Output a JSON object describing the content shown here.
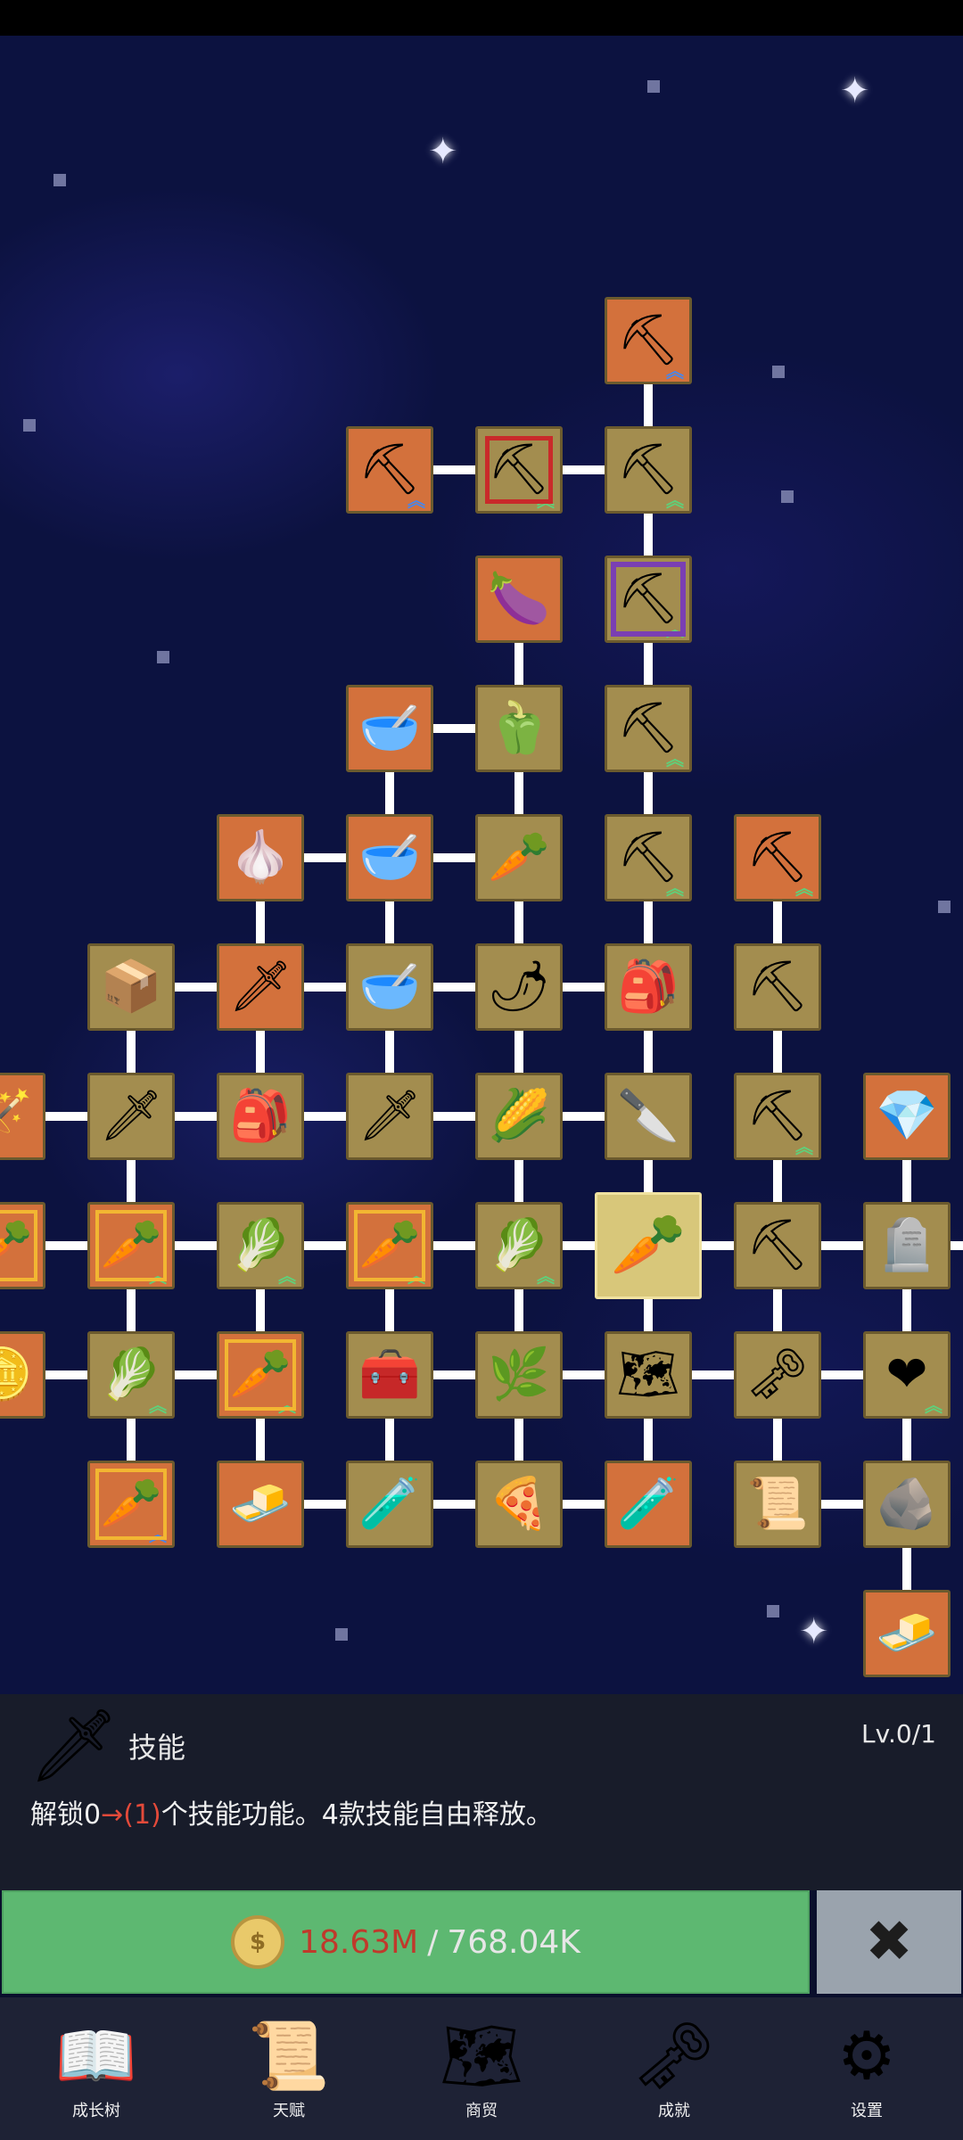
{
  "skill_tree": {
    "nodes": [
      {
        "col": 4,
        "row": 0,
        "color": "orange",
        "icon": "shovel-icon",
        "glyph": "⛏",
        "up": "blue"
      },
      {
        "col": 2,
        "row": 1,
        "color": "orange",
        "icon": "shovel-icon",
        "glyph": "⛏",
        "up": "blue"
      },
      {
        "col": 3,
        "row": 1,
        "color": "olive",
        "icon": "shovel-icon",
        "glyph": "⛏",
        "up": "green",
        "frame": "red"
      },
      {
        "col": 4,
        "row": 1,
        "color": "olive",
        "icon": "shovel-icon",
        "glyph": "⛏",
        "up": "green"
      },
      {
        "col": 3,
        "row": 2,
        "color": "orange",
        "icon": "eggplant-icon",
        "glyph": "🍆"
      },
      {
        "col": 4,
        "row": 2,
        "color": "olive",
        "icon": "shovel-icon",
        "glyph": "⛏",
        "up": "green",
        "frame": "purple"
      },
      {
        "col": 2,
        "row": 3,
        "color": "orange",
        "icon": "bowl-icon",
        "glyph": "🥣"
      },
      {
        "col": 3,
        "row": 3,
        "color": "olive",
        "icon": "pepper-icon",
        "glyph": "🫑"
      },
      {
        "col": 4,
        "row": 3,
        "color": "olive",
        "icon": "shovel-icon",
        "glyph": "⛏",
        "up": "green"
      },
      {
        "col": 1,
        "row": 4,
        "color": "orange",
        "icon": "garlic-icon",
        "glyph": "🧄"
      },
      {
        "col": 2,
        "row": 4,
        "color": "orange",
        "icon": "bowl-icon",
        "glyph": "🥣"
      },
      {
        "col": 3,
        "row": 4,
        "color": "olive",
        "icon": "radish-icon",
        "glyph": "🥕"
      },
      {
        "col": 4,
        "row": 4,
        "color": "olive",
        "icon": "shovel-icon",
        "glyph": "⛏",
        "up": "green"
      },
      {
        "col": 5,
        "row": 4,
        "color": "orange",
        "icon": "pickaxe-icon",
        "glyph": "⛏",
        "up": "green"
      },
      {
        "col": 0,
        "row": 5,
        "color": "olive",
        "icon": "crate-icon",
        "glyph": "📦"
      },
      {
        "col": 1,
        "row": 5,
        "color": "orange",
        "icon": "sword-icon",
        "glyph": "🗡"
      },
      {
        "col": 2,
        "row": 5,
        "color": "olive",
        "icon": "bowl-icon",
        "glyph": "🥣"
      },
      {
        "col": 3,
        "row": 5,
        "color": "olive",
        "icon": "chili-icon",
        "glyph": "🌶"
      },
      {
        "col": 4,
        "row": 5,
        "color": "olive",
        "icon": "backpack-icon",
        "glyph": "🎒"
      },
      {
        "col": 5,
        "row": 5,
        "color": "olive",
        "icon": "pickaxe-icon",
        "glyph": "⛏"
      },
      {
        "col": -1,
        "row": 6,
        "color": "orange",
        "icon": "staff-icon",
        "glyph": "🪄"
      },
      {
        "col": 0,
        "row": 6,
        "color": "olive",
        "icon": "sword-icon",
        "glyph": "🗡"
      },
      {
        "col": 1,
        "row": 6,
        "color": "olive",
        "icon": "backpack-icon",
        "glyph": "🎒"
      },
      {
        "col": 2,
        "row": 6,
        "color": "olive",
        "icon": "sword-icon",
        "glyph": "🗡"
      },
      {
        "col": 3,
        "row": 6,
        "color": "olive",
        "icon": "corn-icon",
        "glyph": "🌽"
      },
      {
        "col": 4,
        "row": 6,
        "color": "olive",
        "icon": "dagger-icon",
        "glyph": "🔪"
      },
      {
        "col": 5,
        "row": 6,
        "color": "olive",
        "icon": "pickaxe-icon",
        "glyph": "⛏",
        "up": "green"
      },
      {
        "col": 6,
        "row": 6,
        "color": "orange",
        "icon": "crystal-icon",
        "glyph": "💎"
      },
      {
        "col": -1,
        "row": 7,
        "color": "orange",
        "icon": "carrot-icon",
        "glyph": "🥕",
        "frame": "gold"
      },
      {
        "col": 0,
        "row": 7,
        "color": "orange",
        "icon": "carrot-icon",
        "glyph": "🥕",
        "up": "green",
        "frame": "gold"
      },
      {
        "col": 1,
        "row": 7,
        "color": "olive",
        "icon": "cabbage-icon",
        "glyph": "🥬",
        "up": "green"
      },
      {
        "col": 2,
        "row": 7,
        "color": "orange",
        "icon": "carrot-icon",
        "glyph": "🥕",
        "up": "green",
        "frame": "gold"
      },
      {
        "col": 3,
        "row": 7,
        "color": "olive",
        "icon": "cabbage-icon",
        "glyph": "🥬",
        "up": "green"
      },
      {
        "col": 4,
        "row": 7,
        "color": "olive",
        "icon": "carrot-icon",
        "glyph": "🥕",
        "selected": true
      },
      {
        "col": 5,
        "row": 7,
        "color": "olive",
        "icon": "pickaxe-icon",
        "glyph": "⛏"
      },
      {
        "col": 6,
        "row": 7,
        "color": "olive",
        "icon": "tombstone-icon",
        "glyph": "🪦"
      },
      {
        "col": -1,
        "row": 8,
        "color": "orange",
        "icon": "coin-icon",
        "glyph": "🪙"
      },
      {
        "col": 0,
        "row": 8,
        "color": "olive",
        "icon": "cabbage-icon",
        "glyph": "🥬",
        "up": "green"
      },
      {
        "col": 1,
        "row": 8,
        "color": "orange",
        "icon": "carrot-icon",
        "glyph": "🥕",
        "up": "green",
        "frame": "gold"
      },
      {
        "col": 2,
        "row": 8,
        "color": "olive",
        "icon": "chest-icon",
        "glyph": "🧰"
      },
      {
        "col": 3,
        "row": 8,
        "color": "olive",
        "icon": "leek-icon",
        "glyph": "🌿"
      },
      {
        "col": 4,
        "row": 8,
        "color": "olive",
        "icon": "map-icon",
        "glyph": "🗺"
      },
      {
        "col": 5,
        "row": 8,
        "color": "olive",
        "icon": "key-icon",
        "glyph": "🗝"
      },
      {
        "col": 6,
        "row": 8,
        "color": "olive",
        "icon": "heart-icon",
        "glyph": "❤",
        "up": "green"
      },
      {
        "col": 0,
        "row": 9,
        "color": "orange",
        "icon": "carrot-icon",
        "glyph": "🥕",
        "up": "blue",
        "frame": "gold"
      },
      {
        "col": 1,
        "row": 9,
        "color": "orange",
        "icon": "gold-bar-icon",
        "glyph": "🧈"
      },
      {
        "col": 2,
        "row": 9,
        "color": "olive",
        "icon": "potion-icon",
        "glyph": "🧪"
      },
      {
        "col": 3,
        "row": 9,
        "color": "olive",
        "icon": "pizza-icon",
        "glyph": "🍕"
      },
      {
        "col": 4,
        "row": 9,
        "color": "orange",
        "icon": "potion-icon",
        "glyph": "🧪"
      },
      {
        "col": 5,
        "row": 9,
        "color": "olive",
        "icon": "scroll-icon",
        "glyph": "📜"
      },
      {
        "col": 6,
        "row": 9,
        "color": "olive",
        "icon": "rock-icon",
        "glyph": "🪨"
      },
      {
        "col": 6,
        "row": 10,
        "color": "orange",
        "icon": "gold-bar-icon",
        "glyph": "🧈"
      }
    ],
    "links_h": [
      [
        2,
        1
      ],
      [
        3,
        1
      ],
      [
        2,
        3
      ],
      [
        1,
        4
      ],
      [
        2,
        4
      ],
      [
        0,
        5
      ],
      [
        1,
        5
      ],
      [
        2,
        5
      ],
      [
        3,
        5
      ],
      [
        -1,
        6
      ],
      [
        0,
        6
      ],
      [
        1,
        6
      ],
      [
        2,
        6
      ],
      [
        3,
        6
      ],
      [
        -1,
        7
      ],
      [
        0,
        7
      ],
      [
        1,
        7
      ],
      [
        2,
        7
      ],
      [
        3,
        7
      ],
      [
        4,
        7
      ],
      [
        5,
        7
      ],
      [
        6,
        7
      ],
      [
        -1,
        8
      ],
      [
        0,
        8
      ],
      [
        2,
        8
      ],
      [
        3,
        8
      ],
      [
        4,
        8
      ],
      [
        5,
        8
      ],
      [
        1,
        9
      ],
      [
        2,
        9
      ],
      [
        3,
        9
      ],
      [
        5,
        9
      ]
    ],
    "links_v": [
      [
        4,
        0
      ],
      [
        4,
        1
      ],
      [
        4,
        2
      ],
      [
        4,
        3
      ],
      [
        4,
        4
      ],
      [
        3,
        2
      ],
      [
        3,
        3
      ],
      [
        3,
        4
      ],
      [
        3,
        5
      ],
      [
        3,
        6
      ],
      [
        3,
        7
      ],
      [
        3,
        8
      ],
      [
        2,
        3
      ],
      [
        2,
        4
      ],
      [
        2,
        5
      ],
      [
        2,
        7
      ],
      [
        2,
        8
      ],
      [
        1,
        4
      ],
      [
        1,
        5
      ],
      [
        1,
        7
      ],
      [
        1,
        8
      ],
      [
        0,
        5
      ],
      [
        0,
        6
      ],
      [
        0,
        7
      ],
      [
        0,
        8
      ],
      [
        4,
        5
      ],
      [
        4,
        6
      ],
      [
        4,
        7
      ],
      [
        4,
        8
      ],
      [
        5,
        4
      ],
      [
        5,
        5
      ],
      [
        5,
        6
      ],
      [
        5,
        7
      ],
      [
        5,
        8
      ],
      [
        6,
        6
      ],
      [
        6,
        7
      ],
      [
        6,
        8
      ],
      [
        6,
        9
      ]
    ]
  },
  "panel": {
    "icon": "sword-icon",
    "title": "技能",
    "level": "Lv.0/1",
    "desc_prefix": "解锁0",
    "desc_arrow": "→",
    "desc_highlight": "(1)",
    "desc_suffix": "个技能功能。4款技能自由释放。"
  },
  "buy_button": {
    "have": "18.63M",
    "separator": "/",
    "need": "768.04K",
    "coin_glyph": "$"
  },
  "close_button": {
    "glyph": "✖"
  },
  "nav": [
    {
      "label": "成长树",
      "icon": "book-icon",
      "glyph": "📖"
    },
    {
      "label": "天赋",
      "icon": "scroll-icon",
      "glyph": "📜"
    },
    {
      "label": "商贸",
      "icon": "map-icon",
      "glyph": "🗺"
    },
    {
      "label": "成就",
      "icon": "key-icon",
      "glyph": "🗝"
    },
    {
      "label": "设置",
      "icon": "gear-icon",
      "glyph": "⚙"
    }
  ]
}
